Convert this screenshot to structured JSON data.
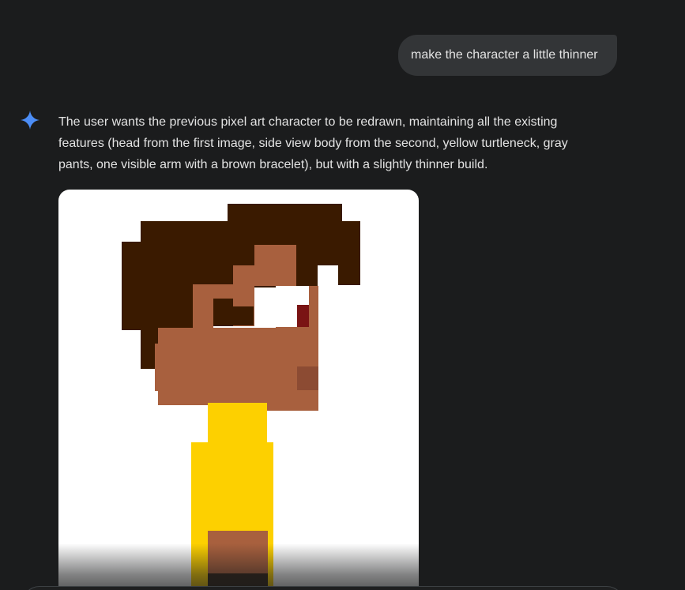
{
  "conversation": {
    "user_message": "make the character a little thinner",
    "model_response": "The user wants the previous pixel art character to be redrawn, maintaining all the existing features (head from the first image, side view body from the second, yellow turtleneck, gray pants, one visible arm with a brown bracelet), but with a slightly thinner build."
  },
  "icons": {
    "model_avatar": "sparkle-icon"
  },
  "colors": {
    "background": "#1b1c1d",
    "user_bubble": "#333537",
    "text": "#e3e3e3",
    "sparkle": "#4c8df6",
    "hair": "#3a1a00",
    "skin": "#a8603e",
    "eye_white": "#ffffff",
    "pupil": "#7a1414",
    "mouth_shadow": "#8c4b33",
    "sweater": "#fdd000",
    "bracelet": "#2e2015"
  }
}
